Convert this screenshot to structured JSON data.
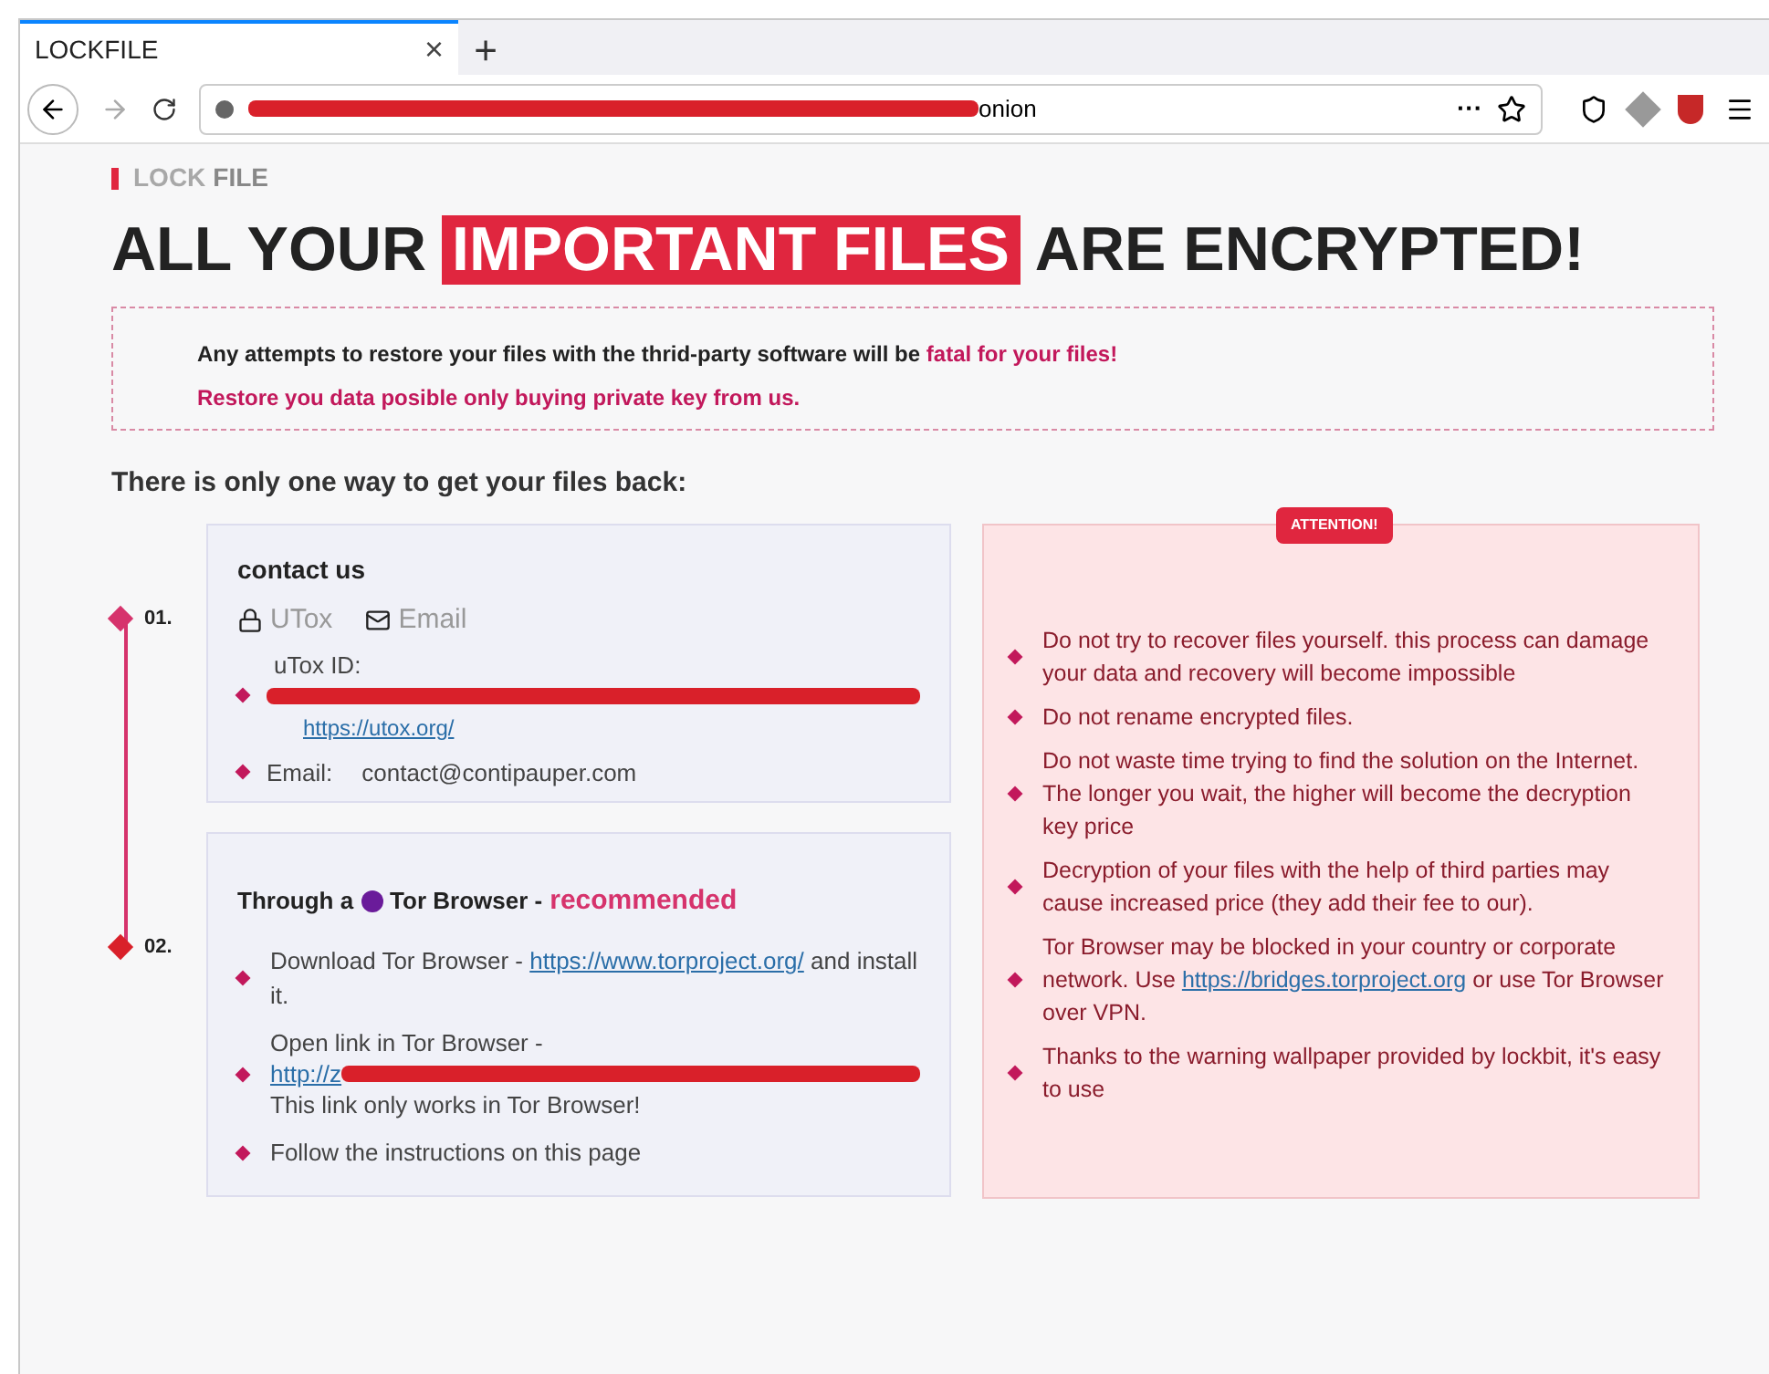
{
  "browser": {
    "tab_title": "LOCKFILE",
    "tab_close": "×",
    "new_tab": "+",
    "address_tail": "onion",
    "more": "···"
  },
  "logo": {
    "part_1": "LOCK",
    "part_2": "FILE"
  },
  "headline": {
    "before": "ALL YOUR",
    "highlight": "IMPORTANT FILES",
    "after": "ARE ENCRYPTED!"
  },
  "warning": {
    "line_1": [
      {
        "text": "Any attempts to restore your files with the thrid-party software will be",
        "emphasis": false
      },
      {
        "text": "fatal for your files!",
        "emphasis": true
      }
    ],
    "line_2": "Restore you data posible only buying private key from us."
  },
  "intro": "There is only one way to get your files back:",
  "steps": [
    "01.",
    "02."
  ],
  "contact": {
    "title": "contact us",
    "methods": [
      {
        "label": "UTox",
        "kind": "lock"
      },
      {
        "label": "Email",
        "kind": "mail"
      }
    ],
    "utox_label": "uTox ID:",
    "utox_link": "https://utox.org/",
    "email_label": "Email:",
    "email_value": "contact@contipauper.com"
  },
  "tor": {
    "title_start": "Through a",
    "title_mid": "Tor Browser -",
    "title_end": "recommended",
    "items": [
      {
        "kind": "link",
        "before": "Download Tor Browser -",
        "link": "https://www.torproject.org/",
        "after": "and install it."
      },
      {
        "kind": "redacted",
        "before": "Open link in Tor Browser -",
        "link": "http://z",
        "after": "This link only works in Tor Browser!"
      },
      {
        "kind": "plain",
        "before": "Follow the instructions on this page"
      }
    ]
  },
  "attention": {
    "badge": "ATTENTION!",
    "items": [
      {
        "text": "Do not try to recover files yourself. this process can damage your data and recovery will become impossible"
      },
      {
        "text": "Do not rename encrypted files."
      },
      {
        "text": "Do not waste time trying to find the solution on the Internet. The longer you wait, the higher will become the decryption key price"
      },
      {
        "text": "Decryption of your files with the help of third parties may cause increased price (they add their fee to our)."
      },
      {
        "text": "Tor Browser may be blocked in your country or corporate network. Use",
        "link": "https://bridges.torproject.org",
        "after": "or use Tor Browser over VPN."
      },
      {
        "text": "Thanks to the warning wallpaper provided by lockbit, it's easy to use"
      }
    ]
  }
}
